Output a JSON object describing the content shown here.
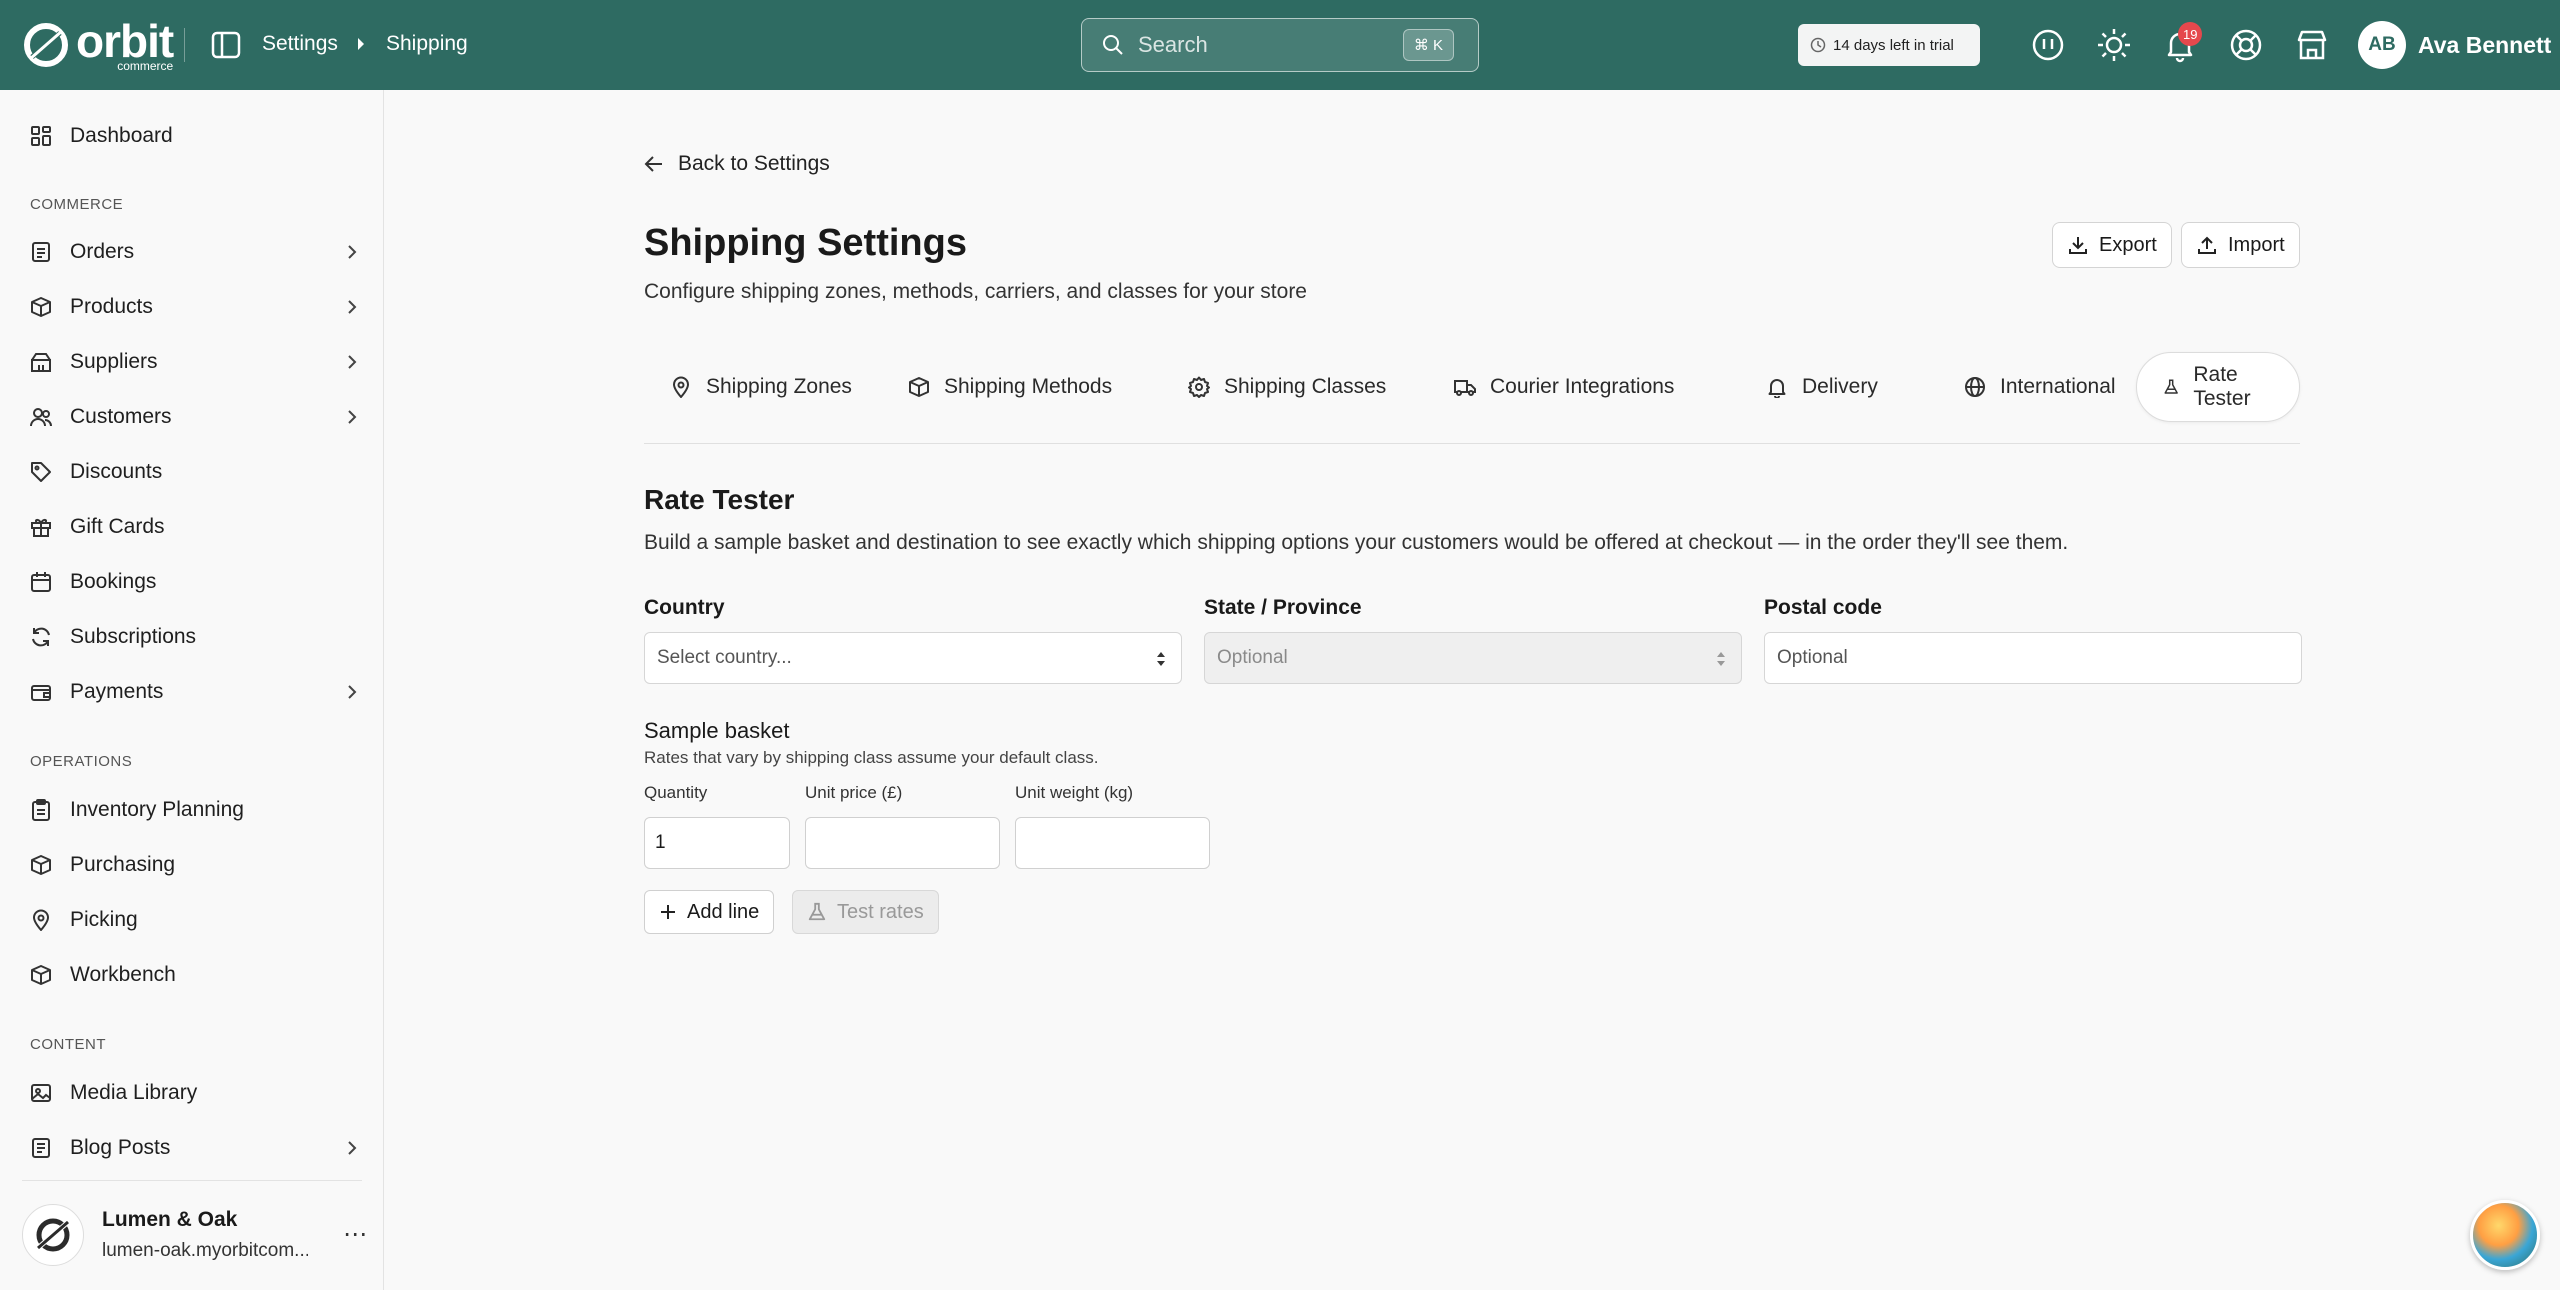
{
  "topbar": {
    "logo_word": "orbit",
    "logo_sub": "commerce",
    "breadcrumb": [
      "Settings",
      "Shipping"
    ],
    "search_placeholder": "Search",
    "search_shortcut": "⌘ K",
    "trial_text": "14 days left in trial",
    "notification_count": "19",
    "user_initials": "AB",
    "user_name": "Ava Bennett",
    "colors": {
      "bar": "#2e6b62",
      "badge": "#e5484d"
    }
  },
  "sidebar": {
    "top_items": [
      {
        "label": "Dashboard",
        "icon": "dashboard-icon"
      }
    ],
    "sections": [
      {
        "title": "COMMERCE",
        "items": [
          {
            "label": "Orders",
            "icon": "orders-icon",
            "has_children": true
          },
          {
            "label": "Products",
            "icon": "products-icon",
            "has_children": true
          },
          {
            "label": "Suppliers",
            "icon": "suppliers-icon",
            "has_children": true
          },
          {
            "label": "Customers",
            "icon": "customers-icon",
            "has_children": true
          },
          {
            "label": "Discounts",
            "icon": "tag-icon",
            "has_children": false
          },
          {
            "label": "Gift Cards",
            "icon": "gift-icon",
            "has_children": false
          },
          {
            "label": "Bookings",
            "icon": "calendar-icon",
            "has_children": false
          },
          {
            "label": "Subscriptions",
            "icon": "refresh-icon",
            "has_children": false
          },
          {
            "label": "Payments",
            "icon": "wallet-icon",
            "has_children": true
          }
        ]
      },
      {
        "title": "OPERATIONS",
        "items": [
          {
            "label": "Inventory Planning",
            "icon": "clipboard-icon",
            "has_children": false
          },
          {
            "label": "Purchasing",
            "icon": "box-icon",
            "has_children": false
          },
          {
            "label": "Picking",
            "icon": "pin-icon",
            "has_children": false
          },
          {
            "label": "Workbench",
            "icon": "cube-icon",
            "has_children": false
          }
        ]
      },
      {
        "title": "CONTENT",
        "items": [
          {
            "label": "Media Library",
            "icon": "image-icon",
            "has_children": false
          },
          {
            "label": "Blog Posts",
            "icon": "document-icon",
            "has_children": true
          }
        ]
      }
    ],
    "store": {
      "name": "Lumen & Oak",
      "url": "lumen-oak.myorbitcom..."
    }
  },
  "main": {
    "back_label": "Back to Settings",
    "title": "Shipping Settings",
    "subtitle": "Configure shipping zones, methods, carriers, and classes for your store",
    "export_label": "Export",
    "import_label": "Import",
    "tabs": [
      {
        "label": "Shipping Zones",
        "icon": "pin-icon",
        "active": false
      },
      {
        "label": "Shipping Methods",
        "icon": "box-icon",
        "active": false
      },
      {
        "label": "Shipping Classes",
        "icon": "gear-icon",
        "active": false
      },
      {
        "label": "Courier Integrations",
        "icon": "truck-icon",
        "active": false
      },
      {
        "label": "Delivery",
        "icon": "bell-icon",
        "active": false
      },
      {
        "label": "International",
        "icon": "globe-icon",
        "active": false
      },
      {
        "label": "Rate Tester",
        "icon": "flask-icon",
        "active": true
      }
    ],
    "rate_tester": {
      "title": "Rate Tester",
      "description": "Build a sample basket and destination to see exactly which shipping options your customers would be offered at checkout — in the order they'll see them.",
      "country_label": "Country",
      "country_value": "Select country...",
      "state_label": "State / Province",
      "state_value": "Optional",
      "postal_label": "Postal code",
      "postal_placeholder": "Optional",
      "basket_title": "Sample basket",
      "basket_note": "Rates that vary by shipping class assume your default class.",
      "quantity_label": "Quantity",
      "quantity_value": "1",
      "price_label": "Unit price (£)",
      "price_value": "",
      "weight_label": "Unit weight (kg)",
      "weight_value": "",
      "add_line_label": "Add line",
      "test_rates_label": "Test rates"
    }
  }
}
